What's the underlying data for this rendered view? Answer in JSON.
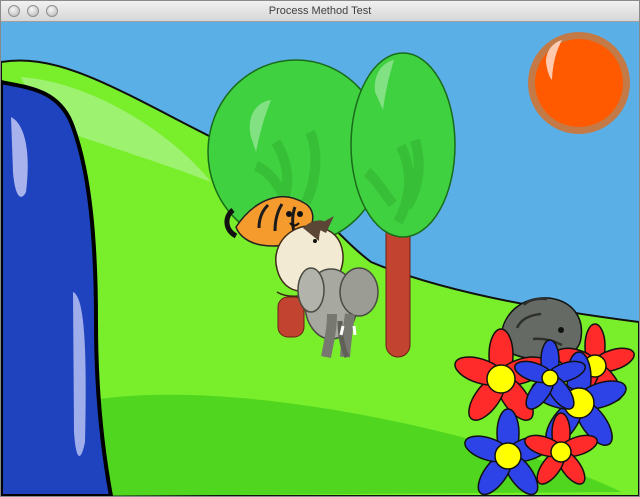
{
  "window": {
    "title": "Process Method Test",
    "buttons": [
      "close",
      "minimize",
      "zoom"
    ]
  },
  "scene": {
    "colors": {
      "sky": "#5ab0e6",
      "hill_light": "#7aef2a",
      "hill_shadow": "#49d11d",
      "river": "#1f43bf",
      "sun": "#ff5a00",
      "sun_ring": "#c37a47",
      "tree_leaf": "#3fd13f",
      "tree_trunk": "#c2432f",
      "flower_red": "#ff2b2b",
      "flower_blue": "#2d43e8",
      "flower_center": "#ffff00"
    },
    "objects": [
      "river",
      "hill",
      "sun",
      "tree-left",
      "tree-right",
      "tiger",
      "cat",
      "elephant",
      "rat",
      "flowers"
    ]
  }
}
